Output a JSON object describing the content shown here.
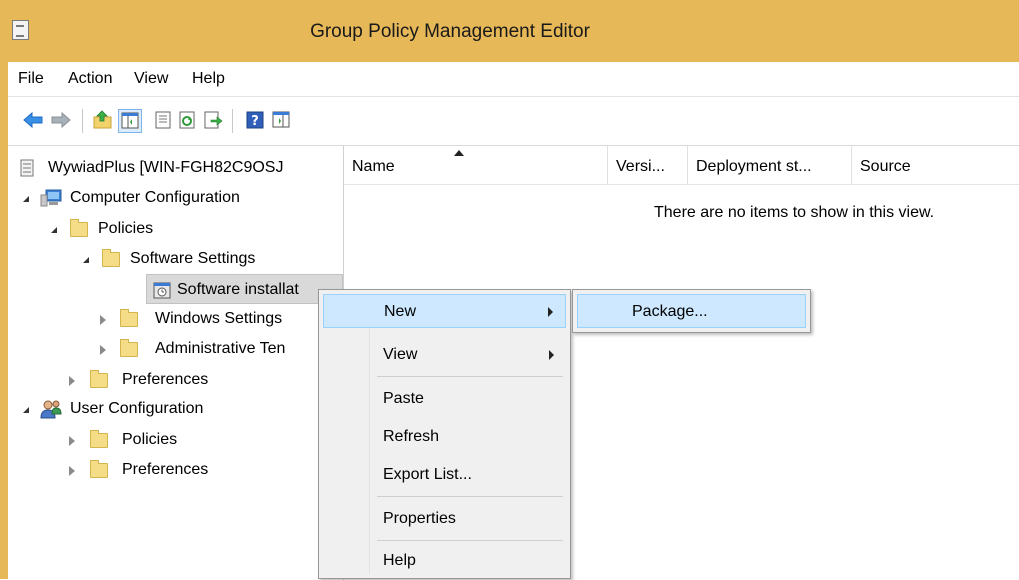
{
  "window": {
    "title": "Group Policy Management Editor"
  },
  "menubar": {
    "items": [
      "File",
      "Action",
      "View",
      "Help"
    ]
  },
  "toolbar": {
    "icons": [
      "back-arrow-icon",
      "forward-arrow-icon",
      "up-folder-icon",
      "show-hide-console-tree-icon",
      "properties-icon",
      "refresh-icon",
      "export-list-icon",
      "help-icon",
      "show-action-pane-icon"
    ]
  },
  "tree": {
    "root": "WywiadPlus [WIN-FGH82C9OSJ",
    "computer_configuration": "Computer Configuration",
    "policies": "Policies",
    "software_settings": "Software Settings",
    "software_installation": "Software installat",
    "windows_settings": "Windows Settings",
    "administrative_templates": "Administrative Ten",
    "preferences": "Preferences",
    "user_configuration": "User Configuration",
    "user_policies": "Policies",
    "user_preferences": "Preferences"
  },
  "list": {
    "columns": [
      "Name",
      "Versi...",
      "Deployment st...",
      "Source"
    ],
    "empty_message": "There are no items to show in this view."
  },
  "context_menu": {
    "items": [
      "New",
      "View",
      "Paste",
      "Refresh",
      "Export List...",
      "Properties",
      "Help"
    ]
  },
  "submenu": {
    "items": [
      "Package..."
    ]
  },
  "colors": {
    "titlebar": "#e7b858",
    "highlight": "#cde8ff",
    "highlight_border": "#99d1ff"
  }
}
